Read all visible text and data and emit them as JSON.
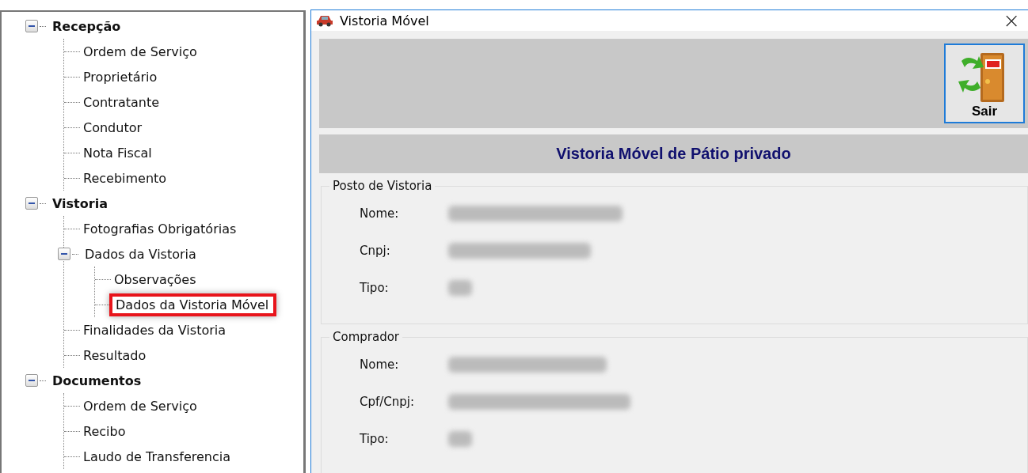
{
  "tree": [
    {
      "label": "Recepção",
      "expanded": true,
      "children": [
        {
          "label": "Ordem de Serviço",
          "highlighted": false
        },
        {
          "label": "Proprietário",
          "highlighted": false
        },
        {
          "label": "Contratante",
          "highlighted": false
        },
        {
          "label": "Condutor",
          "highlighted": false
        },
        {
          "label": "Nota Fiscal",
          "highlighted": false
        },
        {
          "label": "Recebimento",
          "highlighted": false
        }
      ]
    },
    {
      "label": "Vistoria",
      "expanded": true,
      "children": [
        {
          "label": "Fotografias Obrigatórias",
          "highlighted": false
        },
        {
          "label": "Dados da Vistoria",
          "expanded": true,
          "highlighted": false,
          "children": [
            {
              "label": "Observações",
              "highlighted": false
            },
            {
              "label": "Dados da Vistoria Móvel",
              "highlighted": true
            }
          ]
        },
        {
          "label": "Finalidades da Vistoria",
          "highlighted": false
        },
        {
          "label": "Resultado",
          "highlighted": false
        }
      ]
    },
    {
      "label": "Documentos",
      "expanded": true,
      "children": [
        {
          "label": "Ordem de Serviço",
          "highlighted": false
        },
        {
          "label": "Recibo",
          "highlighted": false
        },
        {
          "label": "Laudo de Transferencia",
          "highlighted": false
        }
      ]
    }
  ],
  "window": {
    "title": "Vistoria Móvel",
    "close": "×"
  },
  "toolbar": {
    "exit_button": "Sair"
  },
  "header": "Vistoria Móvel de Pátio privado",
  "groups": [
    {
      "title": "Posto de Vistoria",
      "fields": [
        {
          "label": "Nome:",
          "value_hidden": true
        },
        {
          "label": "Cnpj:",
          "value_hidden": true
        },
        {
          "label": "Tipo:",
          "value_hidden": true
        }
      ]
    },
    {
      "title": "Comprador",
      "fields": [
        {
          "label": "Nome:",
          "value_hidden": true
        },
        {
          "label": "Cpf/Cnpj:",
          "value_hidden": true
        },
        {
          "label": "Tipo:",
          "value_hidden": true
        }
      ]
    }
  ]
}
